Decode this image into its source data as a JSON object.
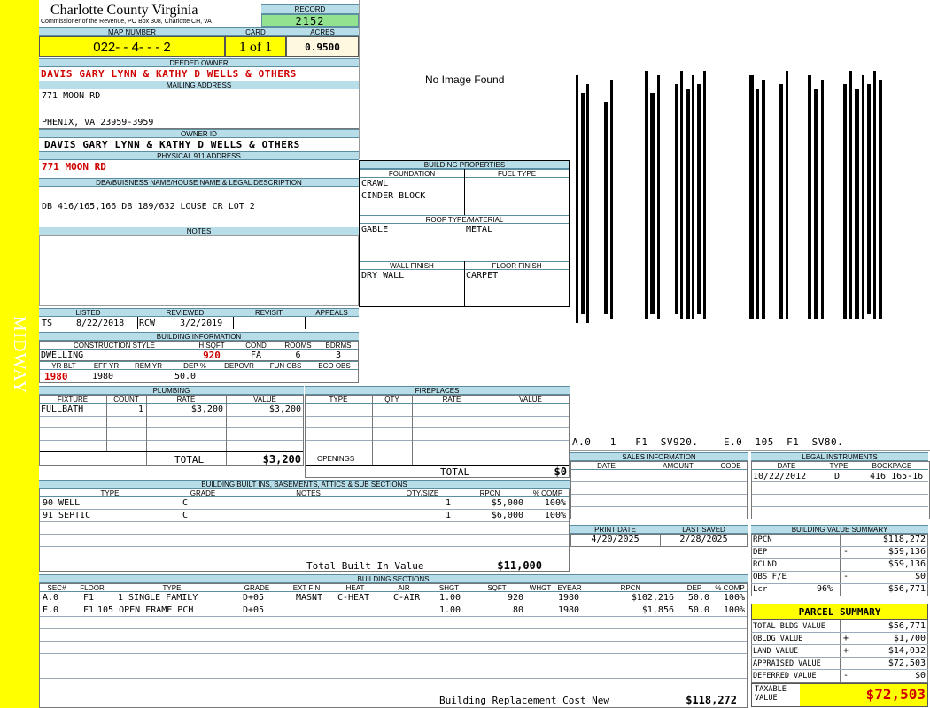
{
  "side_label": "MIDWAY",
  "county": {
    "name": "Charlotte County Virginia",
    "sub": "Commissioner of the Revenue, PO Box 308, Charlotte CH, VA"
  },
  "record": {
    "label": "RECORD",
    "value": "2152"
  },
  "map": {
    "label": "MAP NUMBER",
    "value": "022- - 4- - - 2"
  },
  "card": {
    "label": "CARD",
    "value": "1 of 1"
  },
  "acres": {
    "label": "ACRES",
    "value": "0.9500"
  },
  "deeded": {
    "label": "DEEDED OWNER",
    "value": "DAVIS GARY LYNN & KATHY D WELLS & OTHERS"
  },
  "mailing": {
    "label": "MAILING ADDRESS",
    "line1": "771 MOON RD",
    "line2": "PHENIX, VA 23959-3959"
  },
  "owner_id": {
    "label": "OWNER ID",
    "value": "DAVIS GARY LYNN & KATHY D WELLS & OTHERS"
  },
  "physical": {
    "label": "PHYSICAL 911 ADDRESS",
    "value": "771 MOON RD"
  },
  "dba": {
    "label": "DBA/BUISNESS NAME/HOUSE NAME & LEGAL DESCRIPTION",
    "value": "DB 416/165,166 DB 189/632 LOUSE CR LOT 2"
  },
  "notes": {
    "label": "NOTES"
  },
  "image": {
    "text": "No Image Found"
  },
  "listing": {
    "listed_label": "LISTED",
    "reviewed_label": "REVIEWED",
    "revisit_label": "REVISIT",
    "appeals_label": "APPEALS",
    "listed_by": "TS",
    "listed_date": "8/22/2018",
    "reviewed_by": "RCW",
    "reviewed_date": "3/2/2019"
  },
  "bldg_info": {
    "label": "BUILDING INFORMATION",
    "style_label": "CONSTRUCTION STYLE",
    "hsqft_label": "H SQFT",
    "cond_label": "COND",
    "rooms_label": "ROOMS",
    "bdrms_label": "BDRMS",
    "style": "DWELLING",
    "hsqft": "920",
    "cond": "FA",
    "rooms": "6",
    "bdrms": "3",
    "yrblt_label": "YR BLT",
    "effyr_label": "EFF YR",
    "remyr_label": "REM YR",
    "dep_label": "DEP %",
    "depovr_label": "DEPOVR",
    "funobs_label": "FUN OBS",
    "ecoobs_label": "ECO OBS",
    "yrblt": "1980",
    "effyr": "1980",
    "dep": "50.0"
  },
  "bldg_props": {
    "label": "BUILDING PROPERTIES",
    "foundation_label": "FOUNDATION",
    "fuel_label": "FUEL TYPE",
    "foundation1": "CRAWL",
    "foundation2": "CINDER BLOCK",
    "roof_label": "ROOF TYPE/MATERIAL",
    "roof_type": "GABLE",
    "roof_mat": "METAL",
    "wall_label": "WALL FINISH",
    "floor_label": "FLOOR FINISH",
    "wall": "DRY WALL",
    "floor": "CARPET"
  },
  "sketch": {
    "labels": "A.0   1   F1  SV920.    E.0  105  F1  SV80."
  },
  "plumbing": {
    "label": "PLUMBING",
    "h_fixture": "FIXTURE",
    "h_count": "COUNT",
    "h_rate": "RATE",
    "h_value": "VALUE",
    "rows": [
      {
        "fixture": "FULLBATH",
        "count": "1",
        "rate": "$3,200",
        "value": "$3,200"
      }
    ],
    "total_label": "TOTAL",
    "total": "$3,200"
  },
  "fireplaces": {
    "label": "FIREPLACES",
    "h_type": "TYPE",
    "h_qty": "QTY",
    "h_rate": "RATE",
    "h_value": "VALUE",
    "openings_label": "OPENINGS",
    "total_label": "TOTAL",
    "total": "$0"
  },
  "sales": {
    "label": "SALES INFORMATION",
    "h_date": "DATE",
    "h_amount": "AMOUNT",
    "h_code": "CODE"
  },
  "legal": {
    "label": "LEGAL INSTRUMENTS",
    "h_date": "DATE",
    "h_type": "TYPE",
    "h_book": "BOOKPAGE",
    "date": "10/22/2012",
    "type": "D",
    "book": "416 165-16"
  },
  "print": {
    "print_label": "PRINT DATE",
    "saved_label": "LAST SAVED",
    "print_date": "4/20/2025",
    "saved_date": "2/28/2025"
  },
  "builtins": {
    "label": "BUILDING BUILT INS, BASEMENTS, ATTICS & SUB SECTIONS",
    "h_type": "TYPE",
    "h_grade": "GRADE",
    "h_notes": "NOTES",
    "h_qty": "QTY/SIZE",
    "h_rpcn": "RPCN",
    "h_comp": "% COMP",
    "rows": [
      {
        "type": "90 WELL",
        "grade": "C",
        "qty": "1",
        "rpcn": "$5,000",
        "comp": "100%"
      },
      {
        "type": "91 SEPTIC",
        "grade": "C",
        "qty": "1",
        "rpcn": "$6,000",
        "comp": "100%"
      }
    ],
    "total_label": "Total Built In Value",
    "total": "$11,000"
  },
  "sections": {
    "label": "BUILDING SECTIONS",
    "h_sec": "SEC#",
    "h_floor": "FLOOR",
    "h_type": "TYPE",
    "h_grade": "GRADE",
    "h_extfin": "EXT FIN",
    "h_heat": "HEAT",
    "h_air": "AIR",
    "h_shgt": "SHGT",
    "h_sqft": "SQFT",
    "h_whgt": "WHGT",
    "h_eyear": "EYEAR",
    "h_rpcn": "RPCN",
    "h_dep": "DEP",
    "h_comp": "% COMP",
    "rows": [
      {
        "sec": "A.0",
        "floor": "F1",
        "type": "1 SINGLE FAMILY",
        "grade": "D+05",
        "extfin": "MASNT",
        "heat": "C-HEAT",
        "air": "C-AIR",
        "shgt": "1.00",
        "sqft": "920",
        "eyear": "1980",
        "rpcn": "$102,216",
        "dep": "50.0",
        "comp": "100%"
      },
      {
        "sec": "E.0",
        "floor": "F1",
        "type": "105 OPEN FRAME PCH",
        "grade": "D+05",
        "extfin": "",
        "heat": "",
        "air": "",
        "shgt": "1.00",
        "sqft": "80",
        "eyear": "1980",
        "rpcn": "$1,856",
        "dep": "50.0",
        "comp": "100%"
      }
    ],
    "rcn_label": "Building Replacement Cost New",
    "rcn": "$118,272"
  },
  "value_summary": {
    "label": "BUILDING VALUE SUMMARY",
    "rows": [
      {
        "label": "RPCN",
        "sign": "",
        "value": "$118,272"
      },
      {
        "label": "DEP",
        "sign": "-",
        "value": "$59,136"
      },
      {
        "label": "RCLND",
        "sign": "",
        "value": "$59,136"
      },
      {
        "label": "OBS F/E",
        "sign": "-",
        "value": "$0"
      },
      {
        "label": "Lcr",
        "pct": "96%",
        "sign": "",
        "value": "$56,771"
      }
    ]
  },
  "parcel": {
    "label": "PARCEL SUMMARY",
    "rows": [
      {
        "label": "TOTAL BLDG VALUE",
        "sign": "",
        "value": "$56,771"
      },
      {
        "label": "OBLDG VALUE",
        "sign": "+",
        "value": "$1,700"
      },
      {
        "label": "LAND VALUE",
        "sign": "+",
        "value": "$14,032"
      },
      {
        "label": "APPRAISED VALUE",
        "sign": "",
        "value": "$72,503"
      },
      {
        "label": "DEFERRED VALUE",
        "sign": "-",
        "value": "$0"
      }
    ],
    "taxable_label": "TAXABLE VALUE",
    "taxable": "$72,503"
  },
  "colors": {
    "yellow": "#ffff00",
    "header_blue": "#b7dde8",
    "green": "#92e28f",
    "red": "#d00000"
  }
}
